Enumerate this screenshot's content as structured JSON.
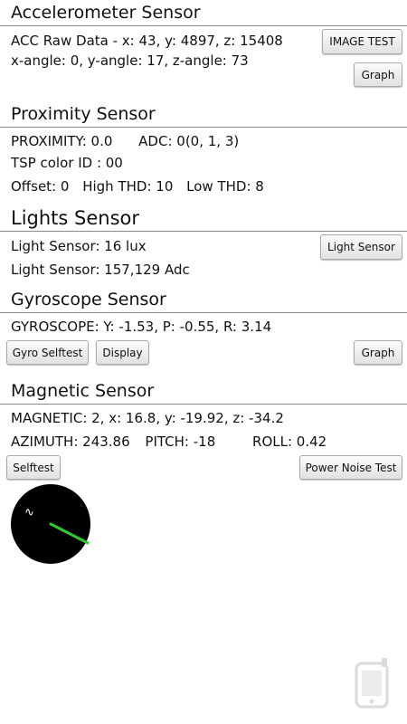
{
  "accelerometer": {
    "title": "Accelerometer Sensor",
    "raw_data": "ACC Raw Data - x: 43, y: 4897, z: 15408",
    "angles": "x-angle: 0, y-angle: 17, z-angle: 73",
    "image_test_label": "IMAGE TEST",
    "graph_label": "Graph"
  },
  "proximity": {
    "title": "Proximity Sensor",
    "proximity_value": "PROXIMITY: 0.0",
    "adc_value": "ADC: 0(0, 1, 3)",
    "tsp_color_id": "TSP color ID : 00",
    "offset": "Offset: 0",
    "high_thd": "High THD: 10",
    "low_thd": "Low THD: 8"
  },
  "lights": {
    "title": "Lights Sensor",
    "lux": "Light Sensor: 16 lux",
    "adc": "Light Sensor: 157,129 Adc",
    "button_label": "Light Sensor"
  },
  "gyroscope": {
    "title": "Gyroscope Sensor",
    "values": "GYROSCOPE: Y: -1.53, P: -0.55, R: 3.14",
    "selftest_label": "Gyro Selftest",
    "display_label": "Display",
    "graph_label": "Graph"
  },
  "magnetic": {
    "title": "Magnetic Sensor",
    "values": "MAGNETIC: 2, x: 16.8, y: -19.92, z: -34.2",
    "azimuth": "AZIMUTH: 243.86",
    "pitch": "PITCH: -18",
    "roll": "ROLL: 0.42",
    "selftest_label": "Selftest",
    "power_noise_label": "Power Noise Test"
  },
  "compass": {
    "dial_color": "#000000",
    "needle_color": "#2ecc2e",
    "marker_glyph": "∿"
  },
  "colors": {
    "background": "#ffffff",
    "divider": "#8a8a8a",
    "text": "#111111"
  }
}
